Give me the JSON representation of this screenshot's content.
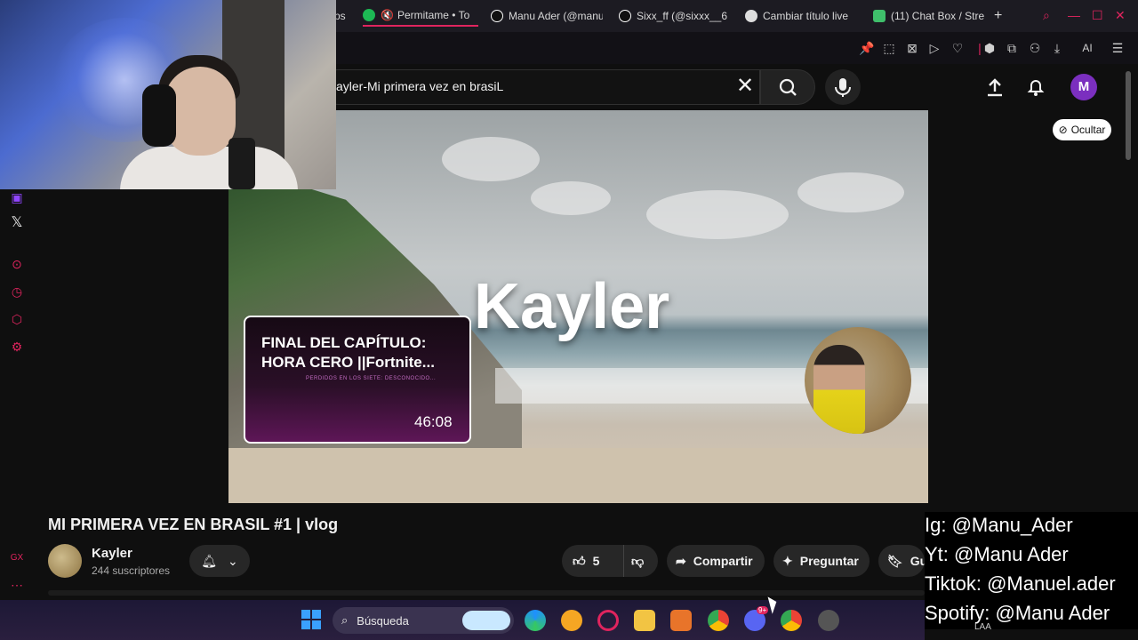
{
  "browser": {
    "tabs": [
      {
        "label": "ps",
        "icon": "generic"
      },
      {
        "label": "Permitame • To",
        "icon": "spotify",
        "muted": true
      },
      {
        "label": "Manu Ader (@manu",
        "icon": "tiktok"
      },
      {
        "label": "Sixx_ff (@sixxx__6",
        "icon": "tiktok"
      },
      {
        "label": "Cambiar título live",
        "icon": "generic"
      },
      {
        "label": "(11) Chat Box / Stre",
        "icon": "streamer"
      }
    ],
    "new_tab": "+",
    "toolbar_ai": "AI"
  },
  "youtube": {
    "search_value": "ayler-Mi primera vez en brasiL",
    "avatar_letter": "M",
    "hide_button": "Ocultar"
  },
  "player": {
    "overlay_title": "Kayler",
    "endcard": {
      "title": "FINAL DEL CAPÍTULO: HORA CERO ||Fortnite...",
      "subtitle": "PERDIDOS EN LOS SIETE: DESCONOCIDO...",
      "duration": "46:08"
    }
  },
  "video": {
    "title": "MI PRIMERA VEZ EN BRASIL #1 | vlog",
    "channel": "Kayler",
    "subscribers": "244 suscriptores",
    "likes": "5",
    "share": "Compartir",
    "ask": "Preguntar",
    "save": "Gu"
  },
  "socials": [
    "Ig: @Manu_Ader",
    "Yt: @Manu Ader",
    "Tiktok: @Manuel.ader",
    "Spotify: @Manu Ader"
  ],
  "taskbar": {
    "search_label": "Búsqueda",
    "tray": "LAA",
    "discord_badge": "9+"
  },
  "colors": {
    "accent": "#e0245e",
    "avatar": "#7b2fbf",
    "background": "#0f0f0f"
  }
}
